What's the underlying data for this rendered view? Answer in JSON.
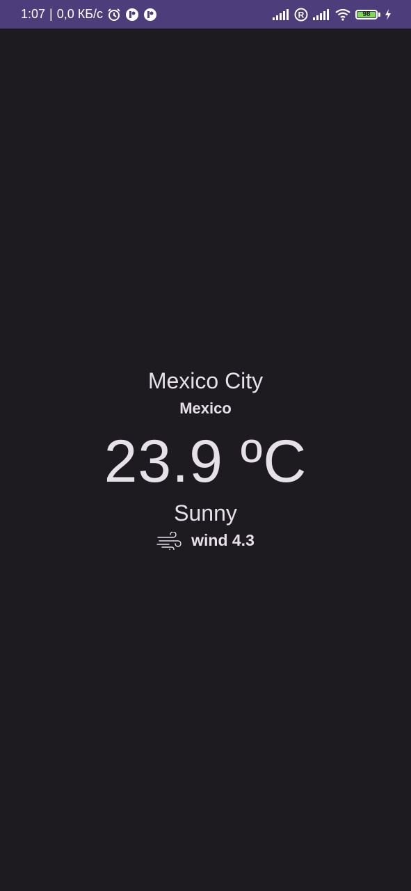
{
  "status_bar": {
    "time": "1:07",
    "separator": "|",
    "data_rate": "0,0 КБ/с",
    "battery_level": "98",
    "icons": [
      "alarm-icon",
      "app-notification-icon",
      "app-notification-icon",
      "signal-icon",
      "roaming-icon",
      "signal-icon",
      "wifi-icon",
      "battery-icon",
      "charging-icon"
    ],
    "background": "#4d3d7a"
  },
  "weather": {
    "city": "Mexico City",
    "country": "Mexico",
    "temperature": "23.9 ºC",
    "condition": "Sunny",
    "wind_label": "wind 4.3",
    "wind_icon": "wind-icon"
  },
  "colors": {
    "background": "#1d1b20",
    "text": "#e6e0e9",
    "battery_fill": "#7ed957"
  }
}
